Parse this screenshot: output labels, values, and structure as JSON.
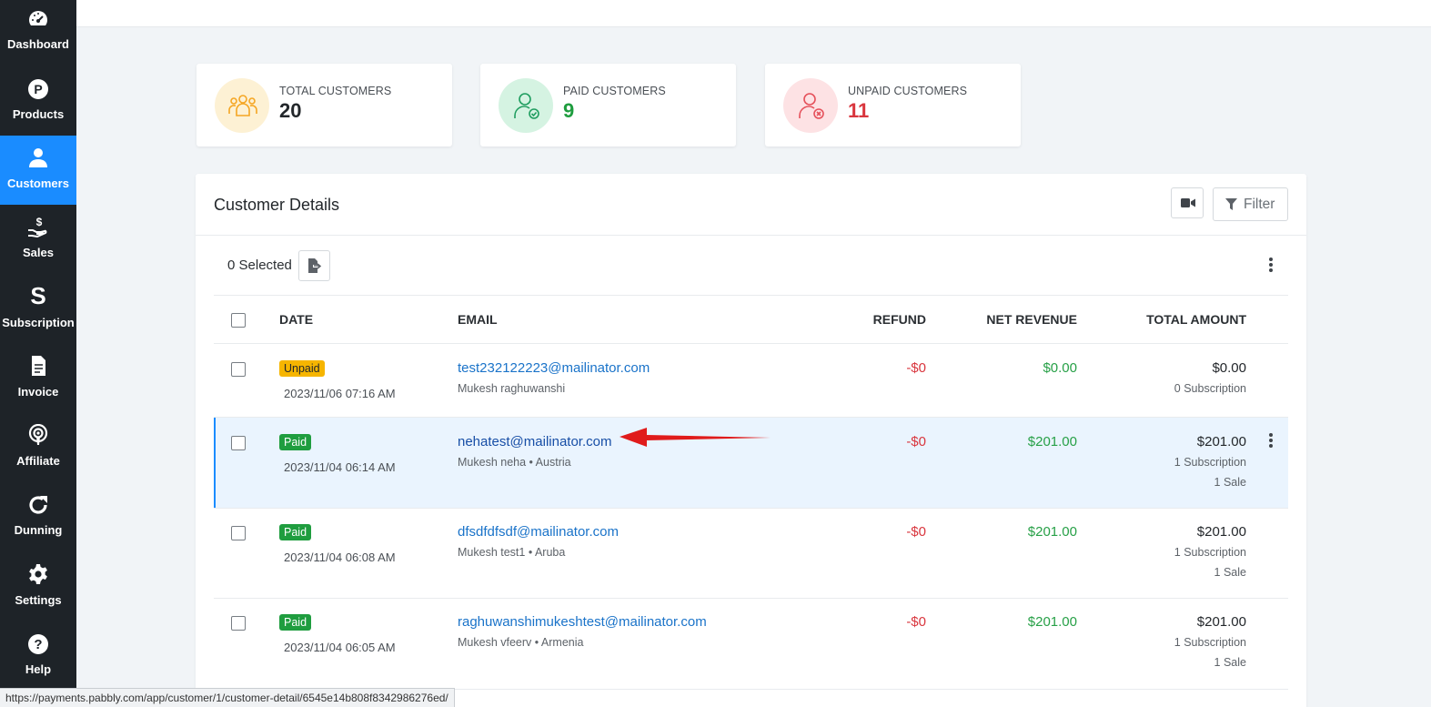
{
  "sidebar": {
    "items": [
      {
        "label": "Dashboard",
        "icon": "gauge-icon"
      },
      {
        "label": "Products",
        "icon": "product-p-icon"
      },
      {
        "label": "Customers",
        "icon": "user-icon"
      },
      {
        "label": "Sales",
        "icon": "hand-dollar-icon"
      },
      {
        "label": "Subscription",
        "icon": "subscription-s-icon"
      },
      {
        "label": "Invoice",
        "icon": "document-icon"
      },
      {
        "label": "Affiliate",
        "icon": "broadcast-icon"
      },
      {
        "label": "Dunning",
        "icon": "refresh-icon"
      },
      {
        "label": "Settings",
        "icon": "gear-icon"
      },
      {
        "label": "Help",
        "icon": "question-icon"
      }
    ],
    "active": "Customers"
  },
  "stats": [
    {
      "title": "TOTAL CUSTOMERS",
      "value": "20",
      "color": "#23272b",
      "circle": "#fdf1d4",
      "icon_color": "#f5a623"
    },
    {
      "title": "PAID CUSTOMERS",
      "value": "9",
      "color": "#1f9d3f",
      "circle": "#d5f3e2",
      "icon_color": "#1f9d5f"
    },
    {
      "title": "UNPAID CUSTOMERS",
      "value": "11",
      "color": "#d9363e",
      "circle": "#fde2e4",
      "icon_color": "#e5505a"
    }
  ],
  "panel": {
    "title": "Customer Details",
    "filter_label": "Filter",
    "selected_label": "0 Selected"
  },
  "table": {
    "columns": [
      "DATE",
      "EMAIL",
      "REFUND",
      "NET REVENUE",
      "TOTAL AMOUNT"
    ],
    "rows": [
      {
        "status": "Unpaid",
        "date": "2023/11/06 07:16 AM",
        "email": "test232122223@mailinator.com",
        "sub": "Mukesh raghuwanshi",
        "refund": "-$0",
        "net": "$0.00",
        "total": "$0.00",
        "meta1": "0 Subscription",
        "meta2": ""
      },
      {
        "status": "Paid",
        "date": "2023/11/04 06:14 AM",
        "email": "nehatest@mailinator.com",
        "sub": "Mukesh neha • Austria",
        "refund": "-$0",
        "net": "$201.00",
        "total": "$201.00",
        "meta1": "1 Subscription",
        "meta2": "1 Sale"
      },
      {
        "status": "Paid",
        "date": "2023/11/04 06:08 AM",
        "email": "dfsdfdfsdf@mailinator.com",
        "sub": "Mukesh test1 • Aruba",
        "refund": "-$0",
        "net": "$201.00",
        "total": "$201.00",
        "meta1": "1 Subscription",
        "meta2": "1 Sale"
      },
      {
        "status": "Paid",
        "date": "2023/11/04 06:05 AM",
        "email": "raghuwanshimukeshtest@mailinator.com",
        "sub": "Mukesh vfeerv • Armenia",
        "refund": "-$0",
        "net": "$201.00",
        "total": "$201.00",
        "meta1": "1 Subscription",
        "meta2": "1 Sale"
      }
    ]
  },
  "status_url": "https://payments.pabbly.com/app/customer/1/customer-detail/6545e14b808f8342986276ed/",
  "colors": {
    "accent": "#1a8cff",
    "sidebar": "#1e2328",
    "annotation_arrow": "#e01b1b"
  }
}
